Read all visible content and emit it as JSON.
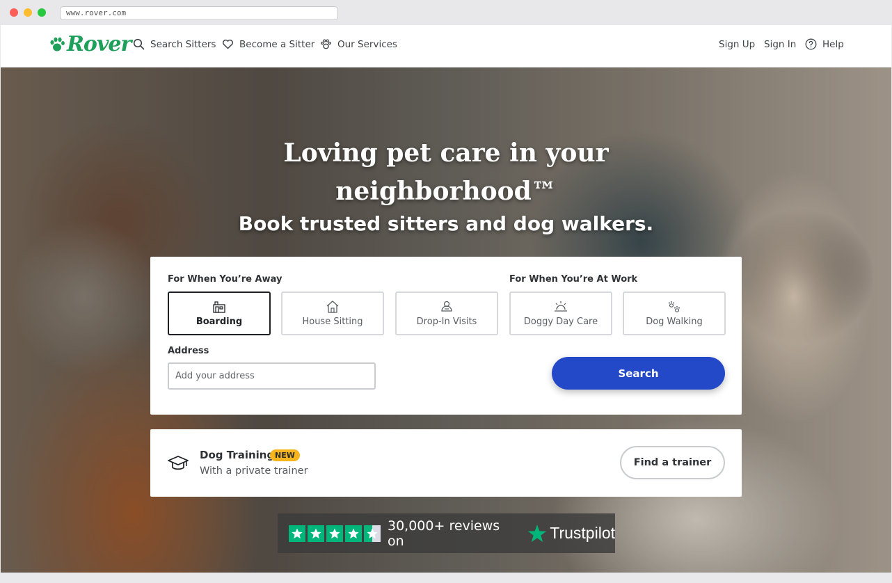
{
  "browser": {
    "url": "www.rover.com"
  },
  "header": {
    "brand": "Rover",
    "nav": [
      {
        "label": "Search Sitters",
        "icon": "search-icon"
      },
      {
        "label": "Become a Sitter",
        "icon": "heart-icon"
      },
      {
        "label": "Our Services",
        "icon": "paw-icon"
      }
    ],
    "right": {
      "sign_up": "Sign Up",
      "sign_in": "Sign In",
      "help": "Help"
    }
  },
  "hero": {
    "title": "Loving pet care in your neighborhood™",
    "subtitle": "Book trusted sitters and dog walkers."
  },
  "search": {
    "away_label": "For When You’re Away",
    "work_label": "For When You’re At Work",
    "services": [
      {
        "label": "Boarding",
        "icon": "boarding-icon",
        "selected": true
      },
      {
        "label": "House Sitting",
        "icon": "house-icon",
        "selected": false
      },
      {
        "label": "Drop-In Visits",
        "icon": "drop-in-icon",
        "selected": false
      },
      {
        "label": "Doggy Day Care",
        "icon": "sun-icon",
        "selected": false
      },
      {
        "label": "Dog Walking",
        "icon": "paw-prints-icon",
        "selected": false
      }
    ],
    "address_label": "Address",
    "address_placeholder": "Add your address",
    "search_button": "Search"
  },
  "training": {
    "title": "Dog Training",
    "badge": "NEW",
    "subtitle": "With a private trainer",
    "button": "Find a trainer"
  },
  "trustpilot": {
    "reviews_text": "30,000+ reviews on",
    "brand": "Trustpilot",
    "rating_stars": 4.5
  },
  "colors": {
    "brand_green": "#1fa05a",
    "search_blue": "#2348c8",
    "badge_yellow": "#f7b51d",
    "trustpilot_green": "#00b67a"
  }
}
